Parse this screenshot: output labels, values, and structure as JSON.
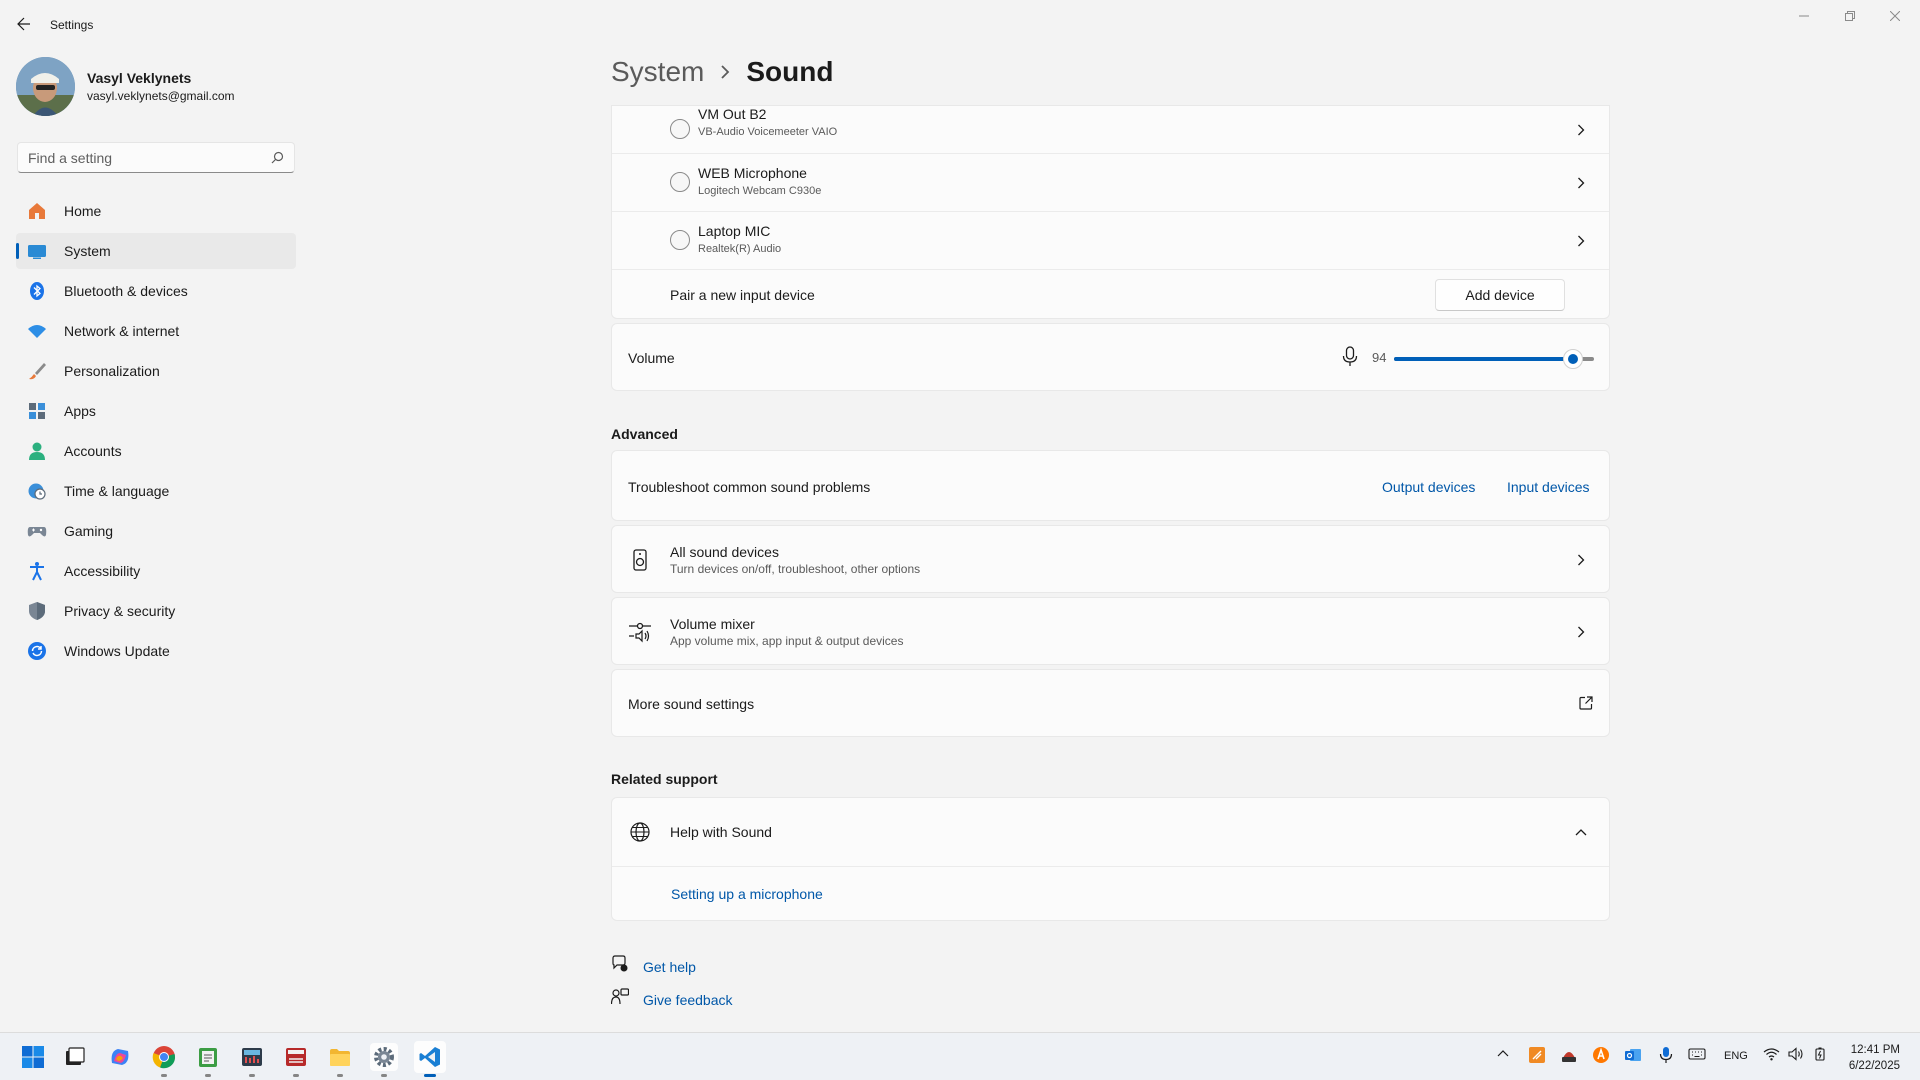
{
  "window": {
    "title": "Settings"
  },
  "profile": {
    "name": "Vasyl Veklynets",
    "email": "vasyl.veklynets@gmail.com"
  },
  "search": {
    "placeholder": "Find a setting"
  },
  "nav": {
    "items": [
      {
        "label": "Home",
        "icon": "home-icon"
      },
      {
        "label": "System",
        "icon": "system-icon",
        "active": true
      },
      {
        "label": "Bluetooth & devices",
        "icon": "bluetooth-icon"
      },
      {
        "label": "Network & internet",
        "icon": "wifi-icon"
      },
      {
        "label": "Personalization",
        "icon": "brush-icon"
      },
      {
        "label": "Apps",
        "icon": "apps-icon"
      },
      {
        "label": "Accounts",
        "icon": "accounts-icon"
      },
      {
        "label": "Time & language",
        "icon": "clock-globe-icon"
      },
      {
        "label": "Gaming",
        "icon": "gamepad-icon"
      },
      {
        "label": "Accessibility",
        "icon": "accessibility-icon"
      },
      {
        "label": "Privacy & security",
        "icon": "shield-icon"
      },
      {
        "label": "Windows Update",
        "icon": "update-icon"
      }
    ]
  },
  "breadcrumb": {
    "parent": "System",
    "current": "Sound"
  },
  "input_devices": [
    {
      "name": "VM Out B2",
      "sub": "VB-Audio Voicemeeter VAIO"
    },
    {
      "name": "WEB Microphone",
      "sub": "Logitech Webcam C930e"
    },
    {
      "name": "Laptop MIC",
      "sub": "Realtek(R) Audio"
    }
  ],
  "pair": {
    "label": "Pair a new input device",
    "button": "Add device"
  },
  "volume": {
    "label": "Volume",
    "value": "94",
    "level": 0.94
  },
  "advanced": {
    "title": "Advanced",
    "troubleshoot": {
      "label": "Troubleshoot common sound problems",
      "output_link": "Output devices",
      "input_link": "Input devices"
    },
    "all_devices": {
      "label": "All sound devices",
      "sub": "Turn devices on/off, troubleshoot, other options"
    },
    "mixer": {
      "label": "Volume mixer",
      "sub": "App volume mix, app input & output devices"
    },
    "more": {
      "label": "More sound settings"
    }
  },
  "support": {
    "title": "Related support",
    "help": {
      "label": "Help with Sound",
      "link": "Setting up a microphone"
    }
  },
  "footer": {
    "get_help": "Get help",
    "feedback": "Give feedback"
  },
  "tray": {
    "lang": "ENG"
  },
  "clock": {
    "time": "12:41 PM",
    "date": "6/22/2025"
  },
  "colors": {
    "accent": "#005fb8",
    "link": "#0057a8",
    "background": "#f3f3f3",
    "card": "#fbfbfb"
  }
}
